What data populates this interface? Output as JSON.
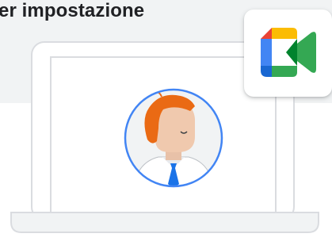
{
  "heading": "er impostazione",
  "icons": {
    "app_icon": "google-meet-icon",
    "avatar": "person-avatar-icon"
  },
  "colors": {
    "meet_blue": "#4285F4",
    "meet_red": "#EA4335",
    "meet_yellow": "#FBBC04",
    "meet_green": "#34A853",
    "avatar_ring": "#4285F4",
    "hair": "#EA6A14"
  }
}
